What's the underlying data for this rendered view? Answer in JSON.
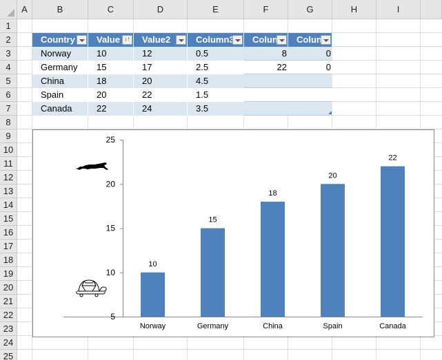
{
  "sheet": {
    "columns": [
      "A",
      "B",
      "C",
      "D",
      "E",
      "F",
      "G",
      "H",
      "I"
    ],
    "rows": [
      "1",
      "2",
      "3",
      "4",
      "5",
      "6",
      "7",
      "8",
      "9",
      "10",
      "11",
      "12",
      "13",
      "14",
      "15",
      "16",
      "17",
      "18",
      "19",
      "20",
      "21",
      "22",
      "23",
      "24",
      "25"
    ]
  },
  "table": {
    "headers": [
      "Country",
      "Value",
      "Value2",
      "Column3",
      "Colun",
      "Colun"
    ],
    "header_filters": [
      "filter",
      "sort-ascending",
      "filter",
      "filter",
      "filter",
      "filter"
    ],
    "rows": [
      [
        "Norway",
        "10",
        "12",
        "0.5",
        "8",
        "0"
      ],
      [
        "Germany",
        "15",
        "17",
        "2.5",
        "22",
        "0"
      ],
      [
        "China",
        "18",
        "20",
        "4.5",
        "",
        ""
      ],
      [
        "Spain",
        "20",
        "22",
        "1.5",
        "",
        ""
      ],
      [
        "Canada",
        "22",
        "24",
        "3.5",
        "",
        ""
      ]
    ],
    "colors": {
      "header": "#4f81bd",
      "band": "#dce6f1"
    }
  },
  "chart_data": {
    "type": "bar",
    "title": "",
    "xlabel": "",
    "ylabel": "",
    "categories": [
      "Norway",
      "Germany",
      "China",
      "Spain",
      "Canada"
    ],
    "values": [
      10,
      15,
      18,
      20,
      22
    ],
    "data_labels": [
      "10",
      "15",
      "18",
      "20",
      "22"
    ],
    "ylim": [
      5,
      25
    ],
    "yticks": [
      5,
      10,
      15,
      20,
      25
    ],
    "ytick_labels": [
      "5",
      "10",
      "15",
      "20",
      "25"
    ],
    "grid": false,
    "legend": "none",
    "bar_color": "#4f81bd",
    "annotations": [
      {
        "type": "icon",
        "name": "cheetah-icon",
        "meaning": "fast",
        "near_y": 22
      },
      {
        "type": "icon",
        "name": "turtle-icon",
        "meaning": "slow",
        "near_y": 7.5
      }
    ]
  }
}
